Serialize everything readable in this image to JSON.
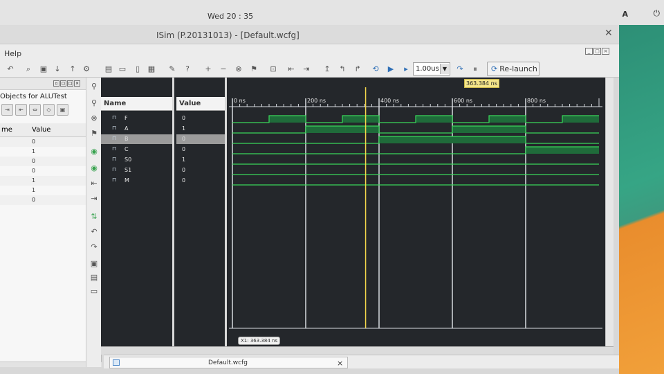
{
  "desktop": {
    "clock": "Wed 20 : 35",
    "user_indicator": "A",
    "power_glyph": "⏻"
  },
  "window": {
    "title": "ISim (P.20131013) - [Default.wcfg]",
    "close_glyph": "✕"
  },
  "menu": {
    "help": "Help"
  },
  "toolbar": {
    "run_time": "1.00us",
    "relaunch_label": "Re-launch"
  },
  "objects_panel": {
    "title": "Objects for ALUTest",
    "col_name": "me",
    "col_value": "Value",
    "rows": [
      {
        "name": "",
        "value": "0"
      },
      {
        "name": "",
        "value": "1"
      },
      {
        "name": "",
        "value": "0"
      },
      {
        "name": "",
        "value": "0"
      },
      {
        "name": "",
        "value": "1"
      },
      {
        "name": "",
        "value": "1"
      },
      {
        "name": "",
        "value": "0"
      }
    ]
  },
  "wave": {
    "name_header": "Name",
    "value_header": "Value",
    "signals": [
      {
        "name": "F",
        "value": "0",
        "selected": false
      },
      {
        "name": "A",
        "value": "1",
        "selected": false
      },
      {
        "name": "B",
        "value": "0",
        "selected": true
      },
      {
        "name": "C",
        "value": "0",
        "selected": false
      },
      {
        "name": "S0",
        "value": "1",
        "selected": false
      },
      {
        "name": "S1",
        "value": "0",
        "selected": false
      },
      {
        "name": "M",
        "value": "0",
        "selected": false
      }
    ],
    "time_labels": [
      "0 ns",
      "200 ns",
      "400 ns",
      "600 ns",
      "800 ns"
    ],
    "cursor_label": "363.384 ns",
    "cursor_readout": "X1: 363.384 ns",
    "colors": {
      "high_fill": "#1f6b3a",
      "line": "#39d75a",
      "cursor": "#f3d64a",
      "grid": "#d7dbe0"
    }
  },
  "tabs": {
    "active": "Default.wcfg"
  }
}
